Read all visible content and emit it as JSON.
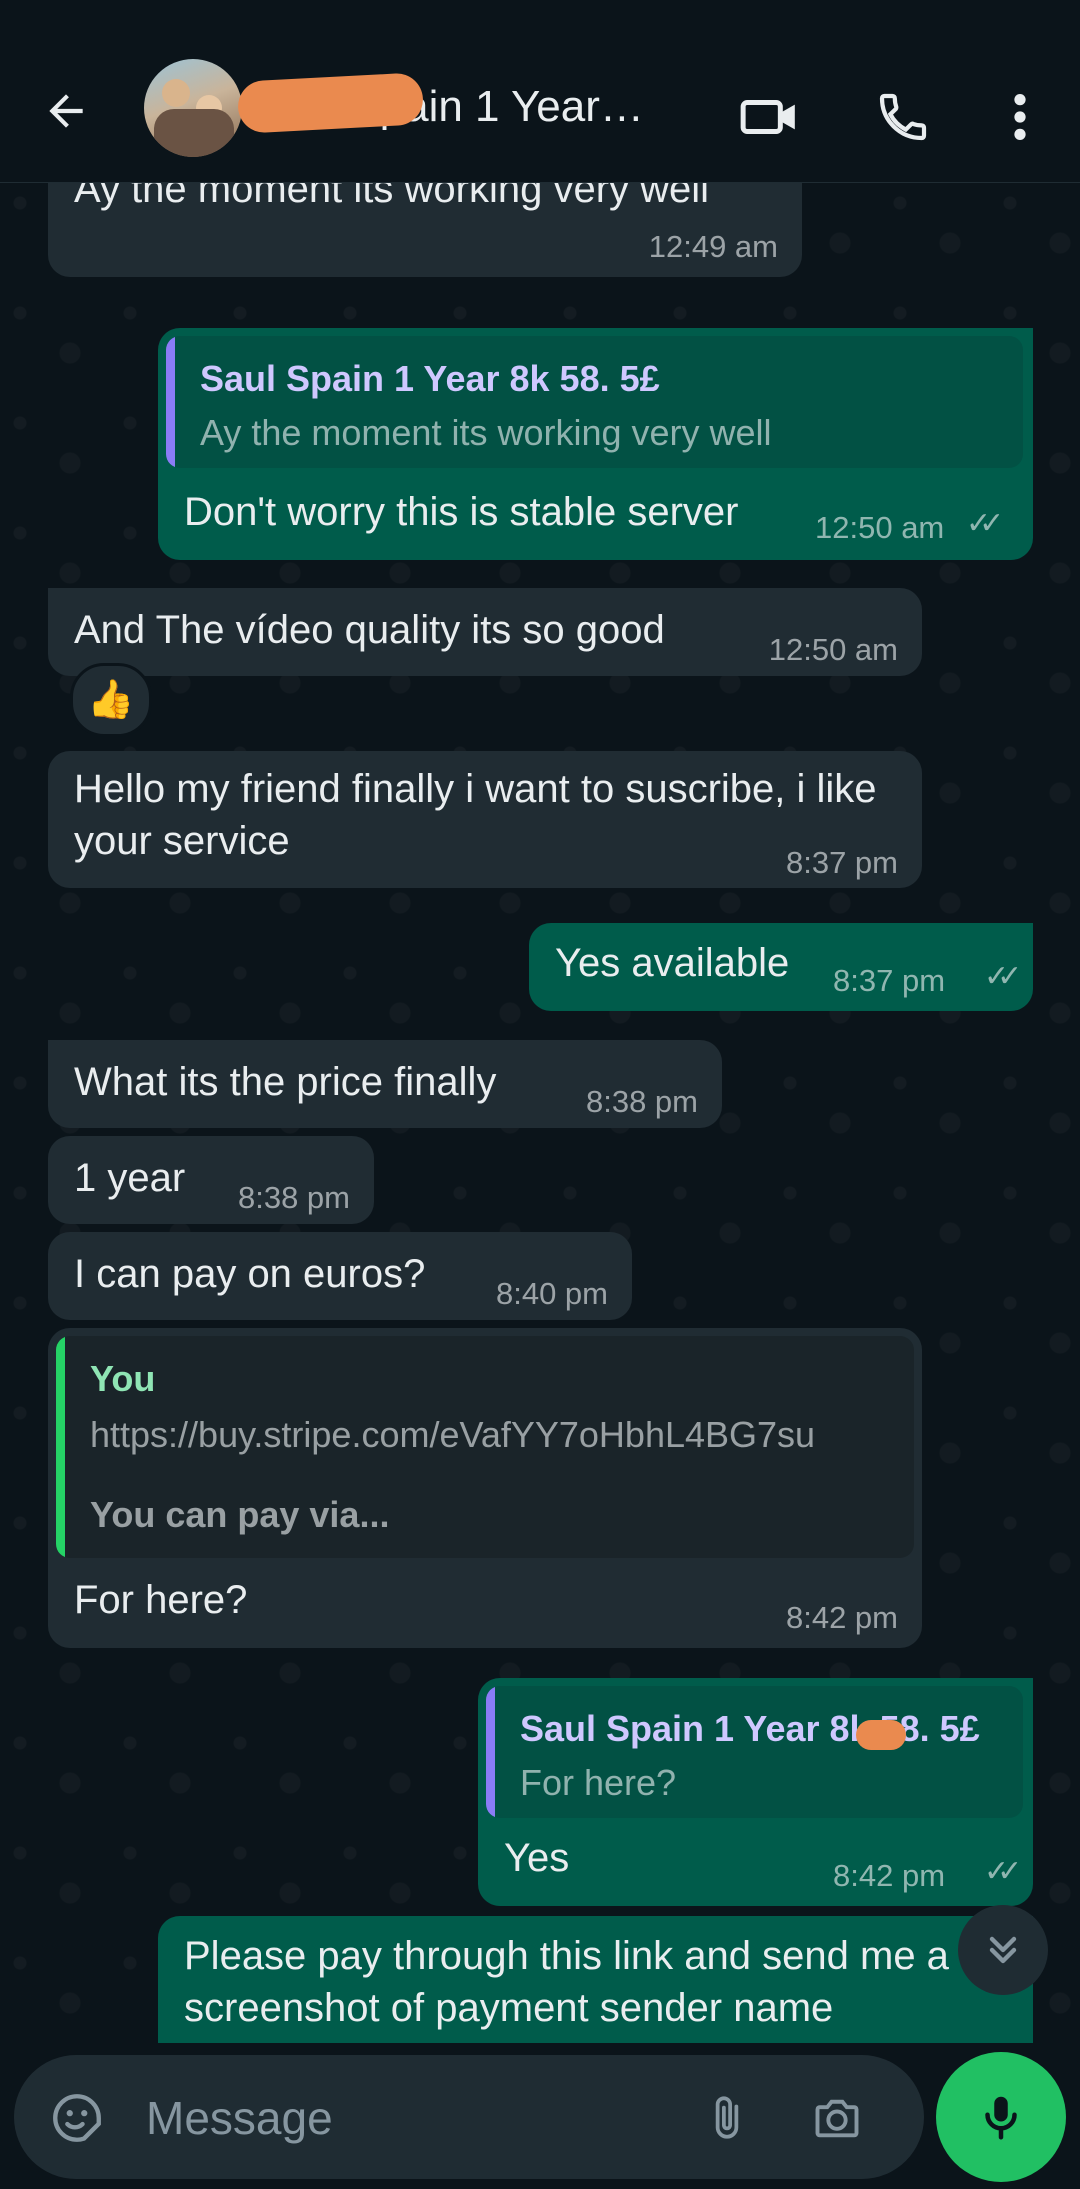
{
  "header": {
    "title": "Saul Spain 1 Year…",
    "back_icon": "arrow-left-icon",
    "video_icon": "video-camera-icon",
    "call_icon": "phone-icon",
    "menu_icon": "more-vertical-icon"
  },
  "messages": [
    {
      "id": "m1",
      "direction": "in",
      "text": "Ay the moment its working very well",
      "time": "12:49 am"
    },
    {
      "id": "m2",
      "direction": "out",
      "quote": {
        "name": "Saul Spain 1 Year 8k 58. 5£",
        "text": "Ay the moment its working very well"
      },
      "text": "Don't worry this is stable server",
      "time": "12:50 am",
      "ticks": "✓✓"
    },
    {
      "id": "m3",
      "direction": "in",
      "text": "And The vídeo quality its so good",
      "time": "12:50 am",
      "reaction": "👍"
    },
    {
      "id": "m4",
      "direction": "in",
      "text": "Hello my friend finally i want to suscribe, i like your service",
      "time": "8:37 pm"
    },
    {
      "id": "m5",
      "direction": "out",
      "text": "Yes available",
      "time": "8:37 pm",
      "ticks": "✓✓"
    },
    {
      "id": "m6",
      "direction": "in",
      "text": "What its the price finally",
      "time": "8:38 pm"
    },
    {
      "id": "m7",
      "direction": "in",
      "text": "1 year",
      "time": "8:38 pm"
    },
    {
      "id": "m8",
      "direction": "in",
      "text": "I can pay on euros?",
      "time": "8:40 pm"
    },
    {
      "id": "m9",
      "direction": "in",
      "quote": {
        "name": "You",
        "text": "https://buy.stripe.com/eVafYY7oHbhL4BG7su",
        "text2": "You can pay via..."
      },
      "text": "For here?",
      "time": "8:42 pm"
    },
    {
      "id": "m10",
      "direction": "out",
      "quote": {
        "name": "Saul Spain 1 Year 8k 58. 5£",
        "text": "For here?"
      },
      "text": "Yes",
      "time": "8:42 pm",
      "ticks": "✓✓"
    },
    {
      "id": "m11",
      "direction": "out",
      "text": "Please pay through this link and send me a screenshot of payment sender name",
      "time": ""
    }
  ],
  "colors": {
    "background": "#0b141a",
    "incoming_bubble": "#202c33",
    "outgoing_bubble": "#005c4b",
    "quote_bar_out": "#8b7cf6",
    "quote_bar_in": "#25d366",
    "quote_name_out": "#cfc8ff",
    "quote_name_in": "#8fe5b4",
    "mic_button": "#21c063",
    "redaction": "#ea8a4f"
  },
  "composer": {
    "placeholder": "Message",
    "emoji_icon": "sticker-icon",
    "attach_icon": "paperclip-icon",
    "camera_icon": "camera-icon",
    "mic_icon": "microphone-icon"
  },
  "scroll_button_icon": "double-chevron-down-icon"
}
